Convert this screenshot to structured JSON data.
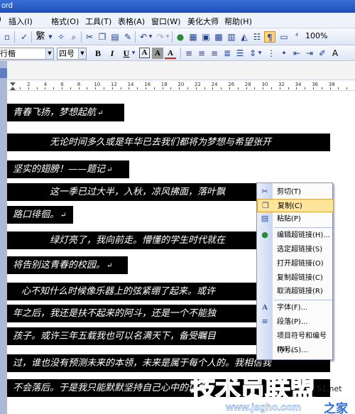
{
  "window": {
    "title": "ord"
  },
  "menu": {
    "items": [
      "插入(I)",
      "格式(O)",
      "工具(T)",
      "表格(A)",
      "窗口(W)",
      "美化大师",
      "帮助(H)"
    ]
  },
  "toolbar": {
    "traditional": "繁",
    "zoom": "100%",
    "zoom_suffix": "%"
  },
  "format": {
    "font_name": "行楷",
    "font_size": "四号",
    "bold": "B",
    "italic": "I",
    "underline": "U",
    "font_color": "A",
    "char_border": "A",
    "char_shade": "A"
  },
  "ruler": {
    "numbers": [
      "2",
      "4",
      "6",
      "8",
      "10",
      "12",
      "14",
      "16",
      "18",
      "20",
      "22",
      "24",
      "26",
      "28",
      "30",
      "32",
      "34",
      "36",
      "38"
    ]
  },
  "document": {
    "lines": [
      "青春飞扬，梦想起航",
      "无论时间多久或是年华已去我们都将为梦想与希望张开",
      "坚实的翅膀！——题记",
      "这一季已过大半，入秋，凉风拂面，落叶飘",
      "路口徘徊。",
      "绿灯亮了，我向前走。懵懂的学生时代就在",
      "将告别这青春的校园。",
      "心不知什么时候像乐器上的弦紧绷了起来。或许",
      "年之后，我还是扶不起来的阿斗，还是一个不能独",
      "孩子。或许三年五载我也可以名满天下，备受瞩目",
      "过，谁也没有预测未来的本领，未来是属于每个人的。我相信我",
      "不会落后。于是我只能默默坚持自己心中的信念，"
    ]
  },
  "context_menu": {
    "items": [
      {
        "label": "剪切(T)",
        "icon": "scissors-icon"
      },
      {
        "label": "复制(C)",
        "icon": "copy-icon",
        "highlighted": true
      },
      {
        "label": "粘贴(P)",
        "icon": "paste-icon"
      },
      {
        "label": "编辑超链接(H)...",
        "icon": "hyperlink-icon"
      },
      {
        "label": "选定超链接(S)"
      },
      {
        "label": "打开超链接(O)"
      },
      {
        "label": "复制超链接(C)"
      },
      {
        "label": "取消超链接(R)"
      },
      {
        "label": "字体(F)...",
        "icon": "font-icon"
      },
      {
        "label": "段落(P)...",
        "icon": "paragraph-icon"
      },
      {
        "label": "项目符号和编号(N)..."
      },
      {
        "label": "符号(S)..."
      }
    ]
  },
  "watermark": {
    "text": "技术员联盟",
    "number": "51.net",
    "url": "www.jsgho.com",
    "suffix": "之家"
  },
  "colors": {
    "selection": "#000000",
    "menu_highlight": "#ffe59a",
    "watermark_blue": "#2f6fd6"
  }
}
